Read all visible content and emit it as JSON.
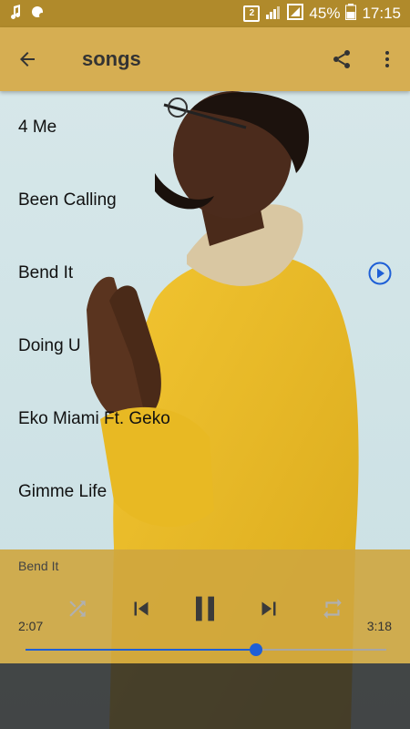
{
  "status_bar": {
    "sim_badge": "2",
    "battery_percent": "45%",
    "time": "17:15",
    "icons": [
      "music-note-icon",
      "notification-icon",
      "signal-icon",
      "battery-icon"
    ]
  },
  "app_bar": {
    "title": "songs",
    "icons": [
      "back-arrow-icon",
      "share-icon",
      "more-vert-icon"
    ],
    "background_color": "#d6ae52"
  },
  "songs": [
    {
      "title": "4 Me",
      "playing": false
    },
    {
      "title": "Been Calling",
      "playing": false
    },
    {
      "title": "Bend It",
      "playing": true
    },
    {
      "title": "Doing U",
      "playing": false
    },
    {
      "title": "Eko Miami Ft. Geko",
      "playing": false
    },
    {
      "title": "Gimme Life",
      "playing": false
    }
  ],
  "player": {
    "now_playing": "Bend It",
    "current_time": "2:07",
    "total_time": "3:18",
    "progress": 0.64,
    "controls": [
      "shuffle-icon",
      "previous-icon",
      "pause-icon",
      "next-icon",
      "repeat-icon"
    ],
    "accent_color": "#1e5fd6"
  }
}
